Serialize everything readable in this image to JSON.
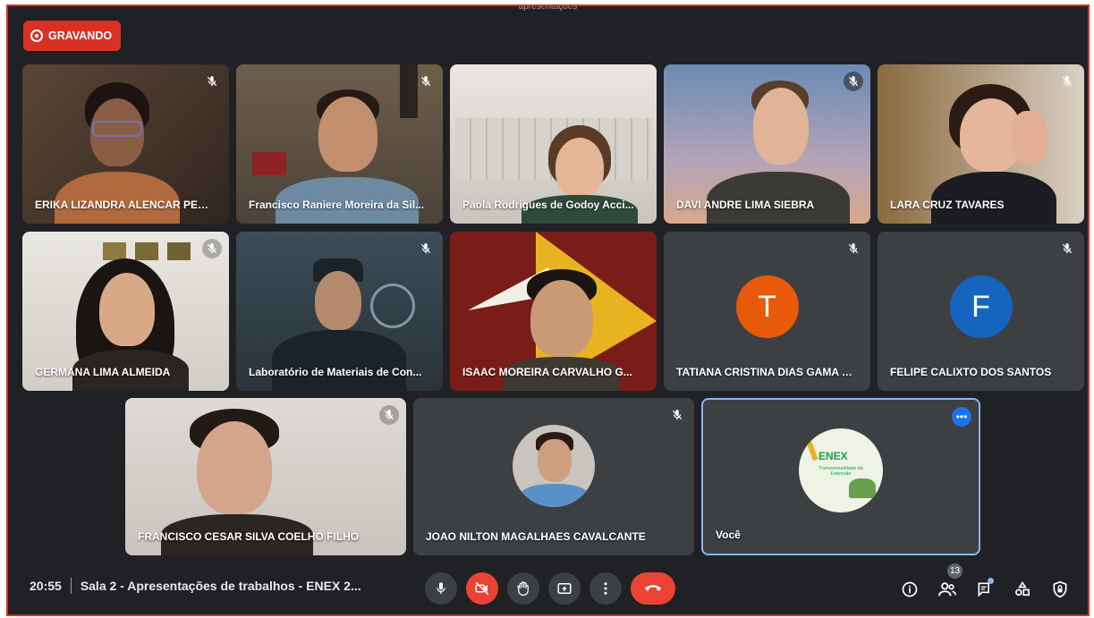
{
  "header": {
    "banner_text": "apresentações"
  },
  "recording": {
    "label": "GRAVANDO"
  },
  "participants": [
    {
      "name": "ERIKA LIZANDRA ALENCAR PER...",
      "muted": true
    },
    {
      "name": "Francisco Raniere Moreira da Sil...",
      "muted": true
    },
    {
      "name": "Paola Rodrigues de Godoy Acci...",
      "muted": false
    },
    {
      "name": "DAVI ANDRE LIMA SIEBRA",
      "muted": true
    },
    {
      "name": "LARA CRUZ TAVARES",
      "muted": true
    },
    {
      "name": "GERMANA LIMA ALMEIDA",
      "muted": true
    },
    {
      "name": "Laboratório de Materiais de Con...",
      "muted": true
    },
    {
      "name": "ISAAC MOREIRA CARVALHO G...",
      "muted": false
    },
    {
      "name": "TATIANA CRISTINA DIAS GAMA N...",
      "muted": true,
      "initial": "T",
      "color": "#e8590c"
    },
    {
      "name": "FELIPE CALIXTO DOS SANTOS",
      "muted": true,
      "initial": "F",
      "color": "#1565c0"
    },
    {
      "name": "FRANCISCO CESAR SILVA COELHO FILHO",
      "muted": true
    },
    {
      "name": "JOAO NILTON MAGALHAES CAVALCANTE",
      "muted": true
    },
    {
      "name": "Você",
      "muted": false,
      "self": true,
      "logo_text": "ENEX",
      "logo_subtitle": "Transversalidade da Extensão"
    }
  ],
  "footer": {
    "time": "20:55",
    "meeting_title": "Sala 2 - Apresentações de trabalhos - ENEX 2...",
    "people_count": "13"
  },
  "colors": {
    "accent": "#8ab4f8",
    "danger": "#ea4335",
    "background": "#202124",
    "tile": "#3c4043"
  }
}
